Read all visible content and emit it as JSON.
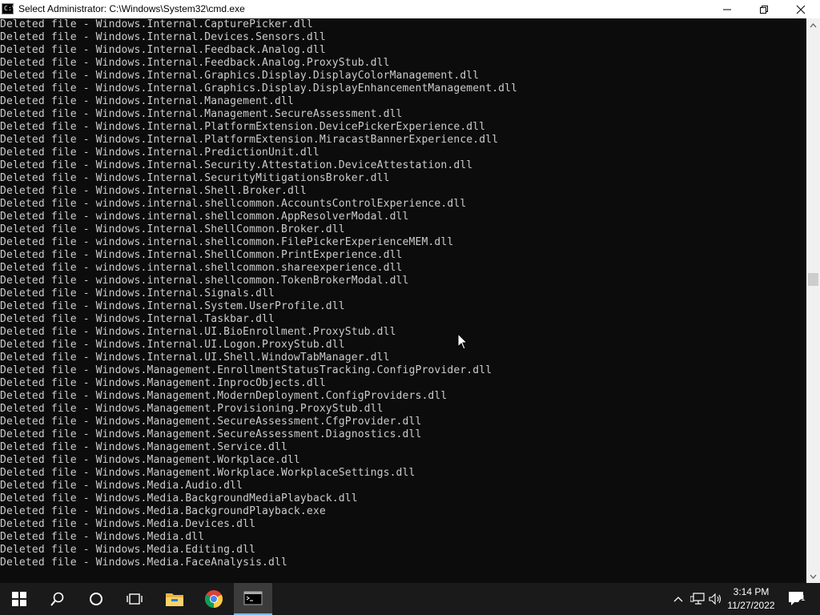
{
  "window": {
    "title": "Select Administrator:  C:\\Windows\\System32\\cmd.exe",
    "icon_text": "C:\\"
  },
  "console": {
    "lines": [
      "Deleted file - Windows.Internal.CapturePicker.dll",
      "Deleted file - Windows.Internal.Devices.Sensors.dll",
      "Deleted file - Windows.Internal.Feedback.Analog.dll",
      "Deleted file - Windows.Internal.Feedback.Analog.ProxyStub.dll",
      "Deleted file - Windows.Internal.Graphics.Display.DisplayColorManagement.dll",
      "Deleted file - Windows.Internal.Graphics.Display.DisplayEnhancementManagement.dll",
      "Deleted file - Windows.Internal.Management.dll",
      "Deleted file - Windows.Internal.Management.SecureAssessment.dll",
      "Deleted file - Windows.Internal.PlatformExtension.DevicePickerExperience.dll",
      "Deleted file - Windows.Internal.PlatformExtension.MiracastBannerExperience.dll",
      "Deleted file - Windows.Internal.PredictionUnit.dll",
      "Deleted file - Windows.Internal.Security.Attestation.DeviceAttestation.dll",
      "Deleted file - Windows.Internal.SecurityMitigationsBroker.dll",
      "Deleted file - Windows.Internal.Shell.Broker.dll",
      "Deleted file - windows.internal.shellcommon.AccountsControlExperience.dll",
      "Deleted file - windows.internal.shellcommon.AppResolverModal.dll",
      "Deleted file - Windows.Internal.ShellCommon.Broker.dll",
      "Deleted file - windows.internal.shellcommon.FilePickerExperienceMEM.dll",
      "Deleted file - Windows.Internal.ShellCommon.PrintExperience.dll",
      "Deleted file - windows.internal.shellcommon.shareexperience.dll",
      "Deleted file - windows.internal.shellcommon.TokenBrokerModal.dll",
      "Deleted file - Windows.Internal.Signals.dll",
      "Deleted file - Windows.Internal.System.UserProfile.dll",
      "Deleted file - Windows.Internal.Taskbar.dll",
      "Deleted file - Windows.Internal.UI.BioEnrollment.ProxyStub.dll",
      "Deleted file - Windows.Internal.UI.Logon.ProxyStub.dll",
      "Deleted file - Windows.Internal.UI.Shell.WindowTabManager.dll",
      "Deleted file - Windows.Management.EnrollmentStatusTracking.ConfigProvider.dll",
      "Deleted file - Windows.Management.InprocObjects.dll",
      "Deleted file - Windows.Management.ModernDeployment.ConfigProviders.dll",
      "Deleted file - Windows.Management.Provisioning.ProxyStub.dll",
      "Deleted file - Windows.Management.SecureAssessment.CfgProvider.dll",
      "Deleted file - Windows.Management.SecureAssessment.Diagnostics.dll",
      "Deleted file - Windows.Management.Service.dll",
      "Deleted file - Windows.Management.Workplace.dll",
      "Deleted file - Windows.Management.Workplace.WorkplaceSettings.dll",
      "Deleted file - Windows.Media.Audio.dll",
      "Deleted file - Windows.Media.BackgroundMediaPlayback.dll",
      "Deleted file - Windows.Media.BackgroundPlayback.exe",
      "Deleted file - Windows.Media.Devices.dll",
      "Deleted file - Windows.Media.dll",
      "Deleted file - Windows.Media.Editing.dll",
      "Deleted file - Windows.Media.FaceAnalysis.dll"
    ]
  },
  "taskbar": {
    "items": [
      "start-icon",
      "search-icon",
      "cortana-icon",
      "task-view-icon",
      "file-explorer-icon",
      "chrome-icon",
      "command-prompt-icon"
    ],
    "tray": [
      "chevron-up-icon",
      "network-icon",
      "volume-icon",
      "notification-icon"
    ],
    "notification_count": "1",
    "time": "3:14 PM",
    "date": "11/27/2022"
  },
  "colors": {
    "console_bg": "#0c0c0c",
    "console_text": "#cccccc",
    "taskbar_bg": "#1a1a1a",
    "active_underline": "#76b9ed"
  }
}
